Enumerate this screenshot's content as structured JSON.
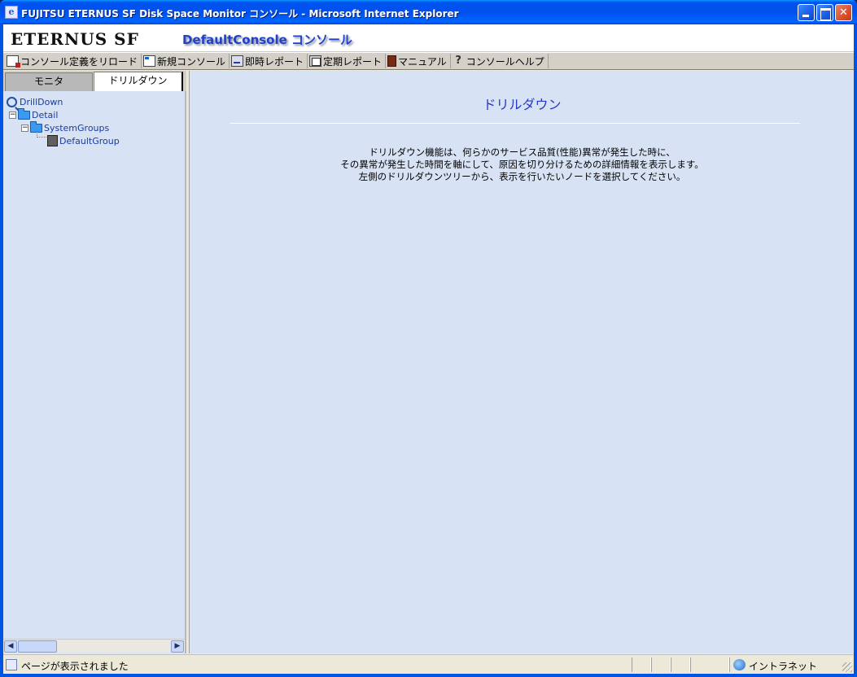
{
  "window": {
    "title": "FUJITSU ETERNUS SF Disk Space Monitor コンソール - Microsoft Internet Explorer",
    "icon": "ie-page-icon",
    "controls": [
      "minimize",
      "maximize",
      "close"
    ]
  },
  "banner": {
    "logo": "ETERNUS SF",
    "console_name": "DefaultConsole コンソール"
  },
  "toolbar": {
    "items": [
      {
        "label": "コンソール定義をリロード",
        "icon": "reload-icon"
      },
      {
        "label": "新規コンソール",
        "icon": "new-console-icon"
      },
      {
        "label": "即時レポート",
        "icon": "instant-report-icon"
      },
      {
        "label": "定期レポート",
        "icon": "periodic-report-icon"
      },
      {
        "label": "マニュアル",
        "icon": "manual-icon"
      },
      {
        "label": "コンソールヘルプ",
        "icon": "help-icon"
      }
    ]
  },
  "sidebar": {
    "tabs": [
      {
        "label": "モニタ",
        "active": false
      },
      {
        "label": "ドリルダウン",
        "active": true
      }
    ],
    "tree": {
      "root": "DrillDown",
      "detail": "Detail",
      "system_groups": "SystemGroups",
      "default_group": "DefaultGroup"
    }
  },
  "main": {
    "title": "ドリルダウン",
    "description": [
      "ドリルダウン機能は、何らかのサービス品質(性能)異常が発生した時に、",
      "その異常が発生した時間を軸にして、原因を切り分けるための詳細情報を表示します。",
      "左側のドリルダウンツリーから、表示を行いたいノードを選択してください。"
    ]
  },
  "statusbar": {
    "text": "ページが表示されました",
    "zone": "イントラネット"
  },
  "colors": {
    "title_bar": "#0054e3",
    "panel_bg": "#d7e3f5",
    "heading": "#2838c8",
    "tree_link": "#1a3aa0"
  }
}
